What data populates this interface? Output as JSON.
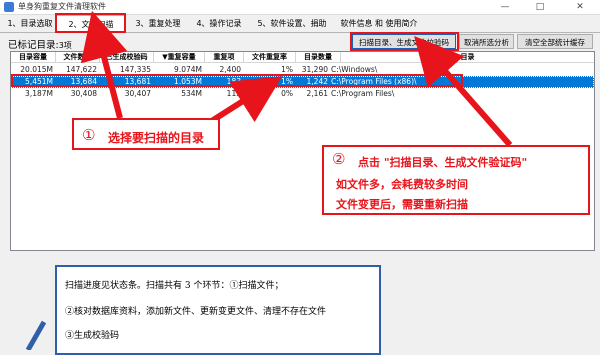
{
  "window": {
    "title": "单身狗重复文件清理软件",
    "minimize": "—",
    "maximize": "□",
    "close": "✕"
  },
  "tabs": [
    {
      "label": "1、目录选取"
    },
    {
      "label": "2、文件扫描"
    },
    {
      "label": "3、重复处理"
    },
    {
      "label": "4、操作记录"
    },
    {
      "label": "5、软件设置、捐助"
    },
    {
      "label": "软件信息 和 使用简介"
    }
  ],
  "summary": {
    "label": "已标记目录:",
    "count": "3项"
  },
  "buttons": {
    "scan": "扫描目录、生成文件校验码",
    "cancel_analysis": "取消所选分析",
    "clear_cache": "清空全部统计缓存"
  },
  "table": {
    "headers": [
      "目录容量",
      "文件数量",
      "已生成校验码",
      "▼重复容量",
      "重复项",
      "文件重复率",
      "目录数量",
      "目录"
    ],
    "rows": [
      {
        "size": "20.015M",
        "files": "147,622",
        "hashed": "147,335",
        "dup_size": "9.074M",
        "dup_items": "2,400",
        "dup_rate": "1%",
        "dirs": "31,290",
        "path": "C:\\Windows\\"
      },
      {
        "size": "5,451M",
        "files": "13,684",
        "hashed": "13,681",
        "dup_size": "1.053M",
        "dup_items": "183",
        "dup_rate": "1%",
        "dirs": "1,242",
        "path": "C:\\Program Files (x86)\\"
      },
      {
        "size": "3,187M",
        "files": "30,408",
        "hashed": "30,407",
        "dup_size": "534M",
        "dup_items": "113",
        "dup_rate": "0%",
        "dirs": "2,161",
        "path": "C:\\Program Files\\"
      }
    ]
  },
  "annotations": {
    "one_num": "①",
    "one_text": "选择要扫描的目录",
    "two_num": "②",
    "two_line1": "点击 \"扫描目录、生成文件验证码\"",
    "two_line2": "如文件多，会耗费较多时间",
    "two_line3": "文件变更后，需要重新扫描"
  },
  "info": {
    "line1": "扫描进度见状态条。扫描共有 3 个环节：①扫描文件；",
    "line2": "②核对数据库资料，添加新文件、更新变更文件、清理不存在文件",
    "line3": "③生成校验码"
  },
  "colors": {
    "annotation_red": "#e8141b",
    "selection_blue": "#0078d7",
    "info_border": "#2e5fa8"
  }
}
